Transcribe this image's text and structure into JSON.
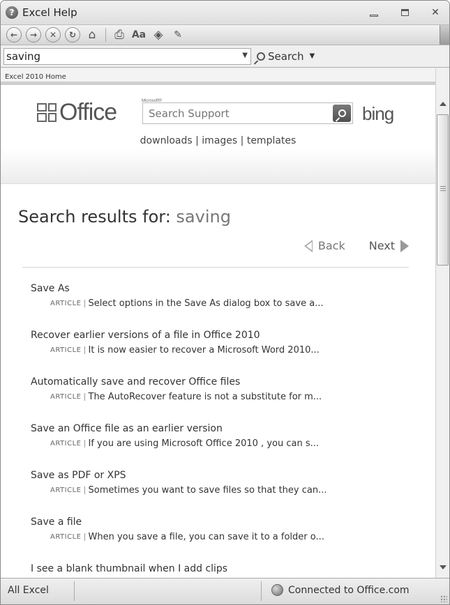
{
  "window": {
    "title": "Excel Help"
  },
  "search": {
    "value": "saving",
    "button_label": "Search"
  },
  "content": {
    "breadcrumb": "Excel 2010 Home",
    "brand": {
      "logo": "Office",
      "ms_tag": "Microsoft®",
      "support_placeholder": "Search Support",
      "bing": "bing"
    },
    "header_links": [
      "downloads",
      "images",
      "templates"
    ],
    "results_prefix": "Search results for: ",
    "query": "saving",
    "pager": {
      "back": "Back",
      "next": "Next"
    },
    "results": [
      {
        "title": "Save As",
        "type": "ARTICLE",
        "snippet": "Select options in the Save As dialog box to save a..."
      },
      {
        "title": "Recover earlier versions of a file in Office 2010",
        "type": "ARTICLE",
        "snippet": "It is now easier to recover a Microsoft Word 2010..."
      },
      {
        "title": "Automatically save and recover Office files",
        "type": "ARTICLE",
        "snippet": "The AutoRecover feature is not a substitute for m..."
      },
      {
        "title": "Save an Office file as an earlier version",
        "type": "ARTICLE",
        "snippet": "If you are using Microsoft Office 2010 , you can s..."
      },
      {
        "title": "Save as PDF or XPS",
        "type": "ARTICLE",
        "snippet": "Sometimes you want to save files so that they can..."
      },
      {
        "title": "Save a file",
        "type": "ARTICLE",
        "snippet": "When you save a file, you can save it to a folder o..."
      },
      {
        "title": "I see a blank thumbnail when I add clips",
        "type": "",
        "snippet": ""
      }
    ]
  },
  "status": {
    "scope": "All Excel",
    "connection": "Connected to Office.com"
  }
}
